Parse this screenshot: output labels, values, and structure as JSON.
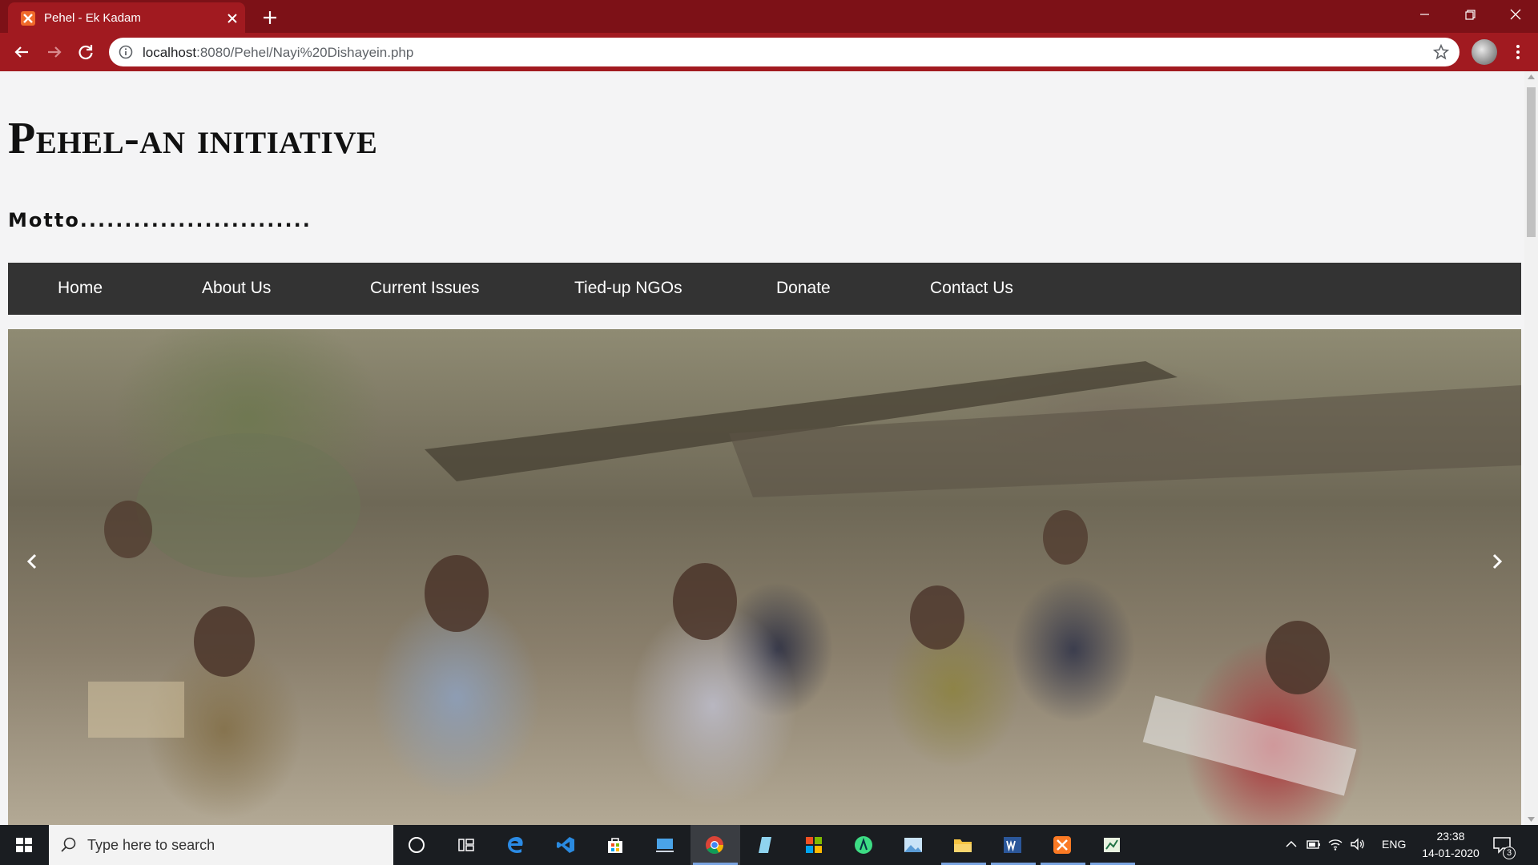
{
  "browser": {
    "tab_title": "Pehel - Ek Kadam",
    "url_host": "localhost",
    "url_path": ":8080/Pehel/Nayi%20Dishayein.php",
    "accent_color": "#a11a20"
  },
  "site": {
    "title": "Pehel-an initiative",
    "motto": "Motto..........................",
    "nav": [
      {
        "label": "Home"
      },
      {
        "label": "About Us"
      },
      {
        "label": "Current Issues"
      },
      {
        "label": "Tied-up NGOs"
      },
      {
        "label": "Donate"
      },
      {
        "label": "Contact Us"
      }
    ],
    "carousel": {
      "prev_label": "‹",
      "next_label": "›"
    }
  },
  "taskbar": {
    "search_placeholder": "Type here to search",
    "language": "ENG",
    "time": "23:38",
    "date": "14-01-2020",
    "notification_count": "3",
    "apps": [
      "cortana-icon",
      "task-view-icon",
      "edge-icon",
      "visual-studio-icon",
      "store-icon",
      "remote-desktop-icon",
      "chrome-icon",
      "notes-icon",
      "office-icon",
      "android-studio-icon",
      "photos-icon",
      "file-explorer-icon",
      "word-icon",
      "xampp-icon",
      "spreadsheet-icon"
    ]
  }
}
